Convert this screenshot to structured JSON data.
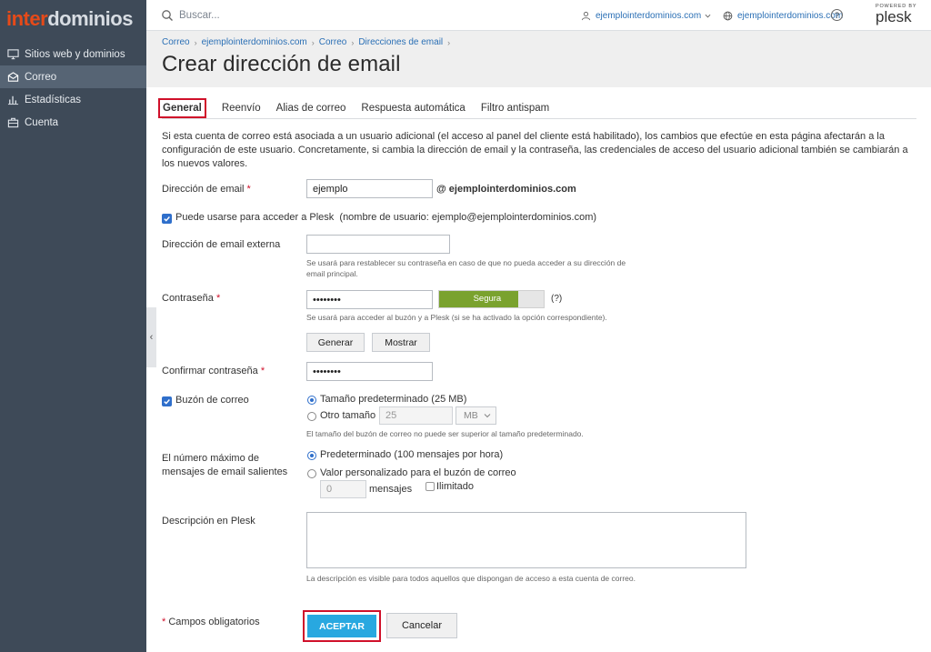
{
  "brand": {
    "logo_a": "inter",
    "logo_b": "dominios"
  },
  "sidebar": {
    "items": [
      {
        "label": "Sitios web y dominios",
        "icon": "monitor-icon",
        "active": false
      },
      {
        "label": "Correo",
        "icon": "mail-icon",
        "active": true
      },
      {
        "label": "Estadísticas",
        "icon": "bar-chart-icon",
        "active": false
      },
      {
        "label": "Cuenta",
        "icon": "briefcase-icon",
        "active": false
      }
    ]
  },
  "header": {
    "search_placeholder": "Buscar...",
    "account": "ejemplointerdominios.com",
    "domain": "ejemplointerdominios.com",
    "help": "?",
    "powered_by": "POWERED BY",
    "plesk": "plesk"
  },
  "breadcrumb": [
    "Correo",
    "ejemplointerdominios.com",
    "Correo",
    "Direcciones de email"
  ],
  "page_title": "Crear dirección de email",
  "tabs": [
    {
      "label": "General",
      "active": true
    },
    {
      "label": "Reenvío",
      "active": false
    },
    {
      "label": "Alias de correo",
      "active": false
    },
    {
      "label": "Respuesta automática",
      "active": false
    },
    {
      "label": "Filtro antispam",
      "active": false
    }
  ],
  "intro_text": "Si esta cuenta de correo está asociada a un usuario adicional (el acceso al panel del cliente está habilitado), los cambios que efectúe en esta página afectarán a la configuración de este usuario. Concretamente, si cambia la dirección de email y la contraseña, las credenciales de acceso del usuario adicional también se cambiarán a los nuevos valores.",
  "form": {
    "email_label": "Dirección de email",
    "required_mark": "*",
    "email_value": "ejemplo",
    "email_domain": "@ ejemplointerdominios.com",
    "plesk_access_label": "Puede usarse para acceder a Plesk",
    "plesk_access_note": "(nombre de usuario: ejemplo@ejemplointerdominios.com)",
    "external_label": "Dirección de email externa",
    "external_value": "",
    "external_hint": "Se usará para restablecer su contraseña en caso de que no pueda acceder a su dirección de email principal.",
    "password_label": "Contraseña",
    "password_value": "••••••••",
    "strength_label": "Segura",
    "strength_level": 0.76,
    "strength_help": "(?)",
    "password_hint": "Se usará para acceder al buzón y a Plesk (si se ha activado la opción correspondiente).",
    "generate_label": "Generar",
    "show_label": "Mostrar",
    "confirm_label": "Confirmar contraseña",
    "confirm_value": "••••••••",
    "mailbox_label": "Buzón de correo",
    "mailbox_default": "Tamaño predeterminado (25 MB)",
    "mailbox_other": "Otro tamaño",
    "mailbox_size_value": "25",
    "mailbox_unit": "MB",
    "mailbox_hint": "El tamaño del buzón de correo no puede ser superior al tamaño predeterminado.",
    "outgoing_label_1": "El número máximo de",
    "outgoing_label_2": "mensajes de email salientes",
    "outgoing_default": "Predeterminado (100 mensajes por hora)",
    "outgoing_custom": "Valor personalizado para el buzón de correo",
    "outgoing_value": "0",
    "outgoing_unit": "mensajes",
    "outgoing_unlimited": "Ilimitado",
    "description_label": "Descripción en Plesk",
    "description_value": "",
    "description_hint": "La descripción es visible para todos aquellos que dispongan de acceso a esta cuenta de correo.",
    "required_note": "Campos obligatorios",
    "accept_label": "ACEPTAR",
    "cancel_label": "Cancelar"
  }
}
